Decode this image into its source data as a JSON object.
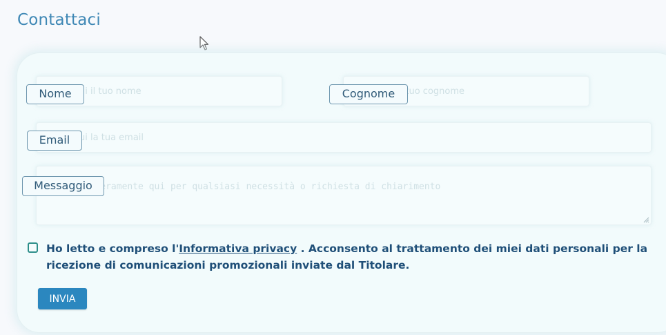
{
  "page": {
    "title": "Contattaci"
  },
  "form": {
    "fields": {
      "nome": {
        "label": "Nome",
        "placeholder": "Scrivi qui il tuo nome"
      },
      "cognome": {
        "label": "Cognome",
        "placeholder": "Scrivi qui il tuo cognome"
      },
      "email": {
        "label": "Email",
        "placeholder": "Scrivi qui la tua email"
      },
      "messaggio": {
        "label": "Messaggio",
        "placeholder": "Scrivi liberamente qui per qualsiasi necessità o richiesta di chiarimento"
      }
    },
    "consent": {
      "checked": false,
      "text_before": "Ho letto e compreso l'",
      "link_text": "Informativa privacy",
      "text_after": " . Acconsento al trattamento dei miei dati personali per la ricezione di comunicazioni promozionali inviate dal Titolare."
    },
    "submit_label": "INVIA"
  },
  "colors": {
    "title": "#3f88b5",
    "label_text": "#2f5a78",
    "label_border": "#6d96ae",
    "consent_text": "#1f4f78",
    "checkbox_border": "#2d8f8a",
    "submit_background": "#2b87bf",
    "card_background": "#f2fbfc",
    "page_background": "#f7f9fc"
  },
  "icons": {
    "cursor": "mouse-pointer-icon",
    "textarea_grip": "resize-grip-icon"
  }
}
